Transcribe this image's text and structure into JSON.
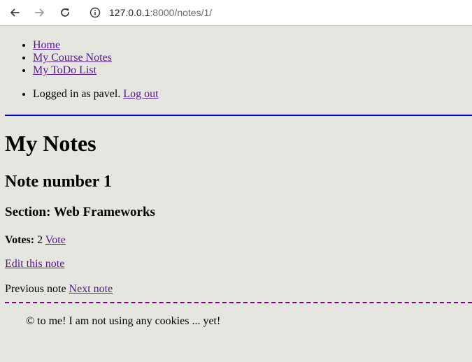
{
  "browser": {
    "url_host": "127.0.0.1",
    "url_rest": ":8000/notes/1/"
  },
  "nav": {
    "items": [
      {
        "label": "Home"
      },
      {
        "label": "My Course Notes"
      },
      {
        "label": "My ToDo List"
      }
    ]
  },
  "user": {
    "prefix": "Logged in as pavel.",
    "logout_label": "Log out"
  },
  "main": {
    "title": "My Notes",
    "note_heading": "Note number 1",
    "section_heading": "Section: Web Frameworks",
    "votes_label": "Votes:",
    "votes_count": "2",
    "vote_link": "Vote",
    "edit_link": "Edit this note",
    "previous_label": "Previous note",
    "next_link": "Next note"
  },
  "footer": {
    "text": "© to me! I am not using any cookies ... yet!"
  },
  "colors": {
    "page_background": "#e6e6e1",
    "link": "#551a8b",
    "header_rule": "#0000cd",
    "footer_rule": "#800080"
  }
}
